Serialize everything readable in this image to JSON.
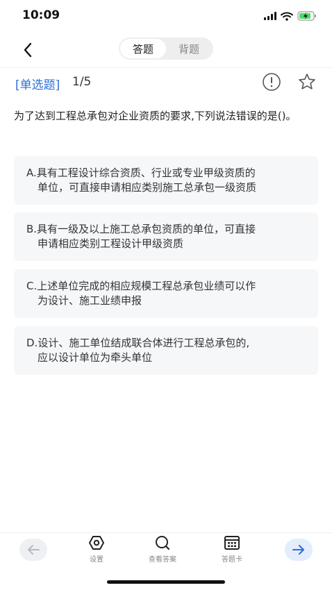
{
  "status_bar": {
    "time": "10:09"
  },
  "nav": {
    "tabs": [
      {
        "label": "答题",
        "active": true
      },
      {
        "label": "背题",
        "active": false
      }
    ]
  },
  "question": {
    "type_label": "[单选题]",
    "progress": "1/5",
    "stem": "为了达到工程总承包对企业资质的要求,下列说法错误的是()。",
    "options": [
      {
        "line1": "A.具有工程设计综合资质、行业或专业甲级资质的",
        "line2": "单位，可直接申请相应类别施工总承包一级资质"
      },
      {
        "line1": "B.具有一级及以上施工总承包资质的单位，可直接",
        "line2": "申请相应类别工程设计甲级资质"
      },
      {
        "line1": "C.上述单位完成的相应规模工程总承包业绩可以作",
        "line2": "为设计、施工业绩申报"
      },
      {
        "line1": "D.设计、施工单位结成联合体进行工程总承包的,",
        "line2": "应以设计单位为牵头单位"
      }
    ]
  },
  "toolbar": {
    "settings_label": "设置",
    "view_answer_label": "查看答案",
    "answer_card_label": "答题卡"
  },
  "colors": {
    "accent": "#2d6fd6",
    "option_bg": "#f6f7f9",
    "next_button_bg": "#e3edfb"
  },
  "icons": [
    "back-chevron-icon",
    "feedback-icon",
    "star-icon",
    "arrow-left-icon",
    "settings-icon",
    "search-icon",
    "calendar-icon",
    "arrow-right-icon"
  ]
}
